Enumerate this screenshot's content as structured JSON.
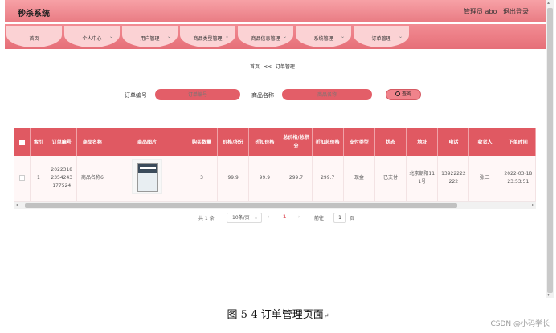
{
  "topbar": {
    "title": "秒杀系统",
    "user_label": "管理员 abo",
    "logout_label": "退出登录"
  },
  "nav": {
    "items": [
      {
        "label": "首页",
        "has_dropdown": false
      },
      {
        "label": "个人中心",
        "has_dropdown": true
      },
      {
        "label": "用户管理",
        "has_dropdown": true
      },
      {
        "label": "商品类型管理",
        "has_dropdown": true
      },
      {
        "label": "商品信息管理",
        "has_dropdown": true
      },
      {
        "label": "系统管理",
        "has_dropdown": true
      },
      {
        "label": "订单管理",
        "has_dropdown": true
      }
    ],
    "chevron_glyph": "⌄"
  },
  "breadcrumb": {
    "home": "首页",
    "separator": "<<",
    "current": "订单管理"
  },
  "search": {
    "order_no_label": "订单编号",
    "order_no_placeholder": "订单编号",
    "product_label": "商品名称",
    "product_placeholder": "商品名称",
    "button_label": "查询"
  },
  "table": {
    "headers": [
      "",
      "索引",
      "订单编号",
      "商品名称",
      "商品图片",
      "购买数量",
      "价格/积分",
      "折扣价格",
      "总价格/总积分",
      "折扣总价格",
      "支付类型",
      "状态",
      "地址",
      "电话",
      "收货人",
      "下单时间"
    ],
    "rows": [
      {
        "index": "1",
        "order_no": "20223182354243177524",
        "product_name": "商品名称6",
        "quantity": "3",
        "price": "99.9",
        "discount_price": "99.9",
        "total_price": "299.7",
        "discount_total": "299.7",
        "pay_type": "现金",
        "status": "已支付",
        "address": "北京朝阳111号",
        "phone": "13922222222",
        "receiver": "张三",
        "order_time": "2022-03-18 23:53:51"
      }
    ]
  },
  "pagination": {
    "total": "共 1 条",
    "page_size": "10条/页",
    "prev": "‹",
    "current_page": "1",
    "next": "›",
    "goto_label": "前往",
    "goto_value": "1",
    "page_unit": "页"
  },
  "scrollbar": {
    "left": "◂",
    "right": "▸",
    "up": "▴",
    "down": "▾"
  },
  "caption": {
    "text": "图 5-4 订单管理页面",
    "mark": "↵"
  },
  "watermark": "CSDN @小码学长",
  "colors": {
    "primary": "#e05962",
    "nav_pill": "#fbd2d4",
    "topbar": "#f7a1a6"
  }
}
